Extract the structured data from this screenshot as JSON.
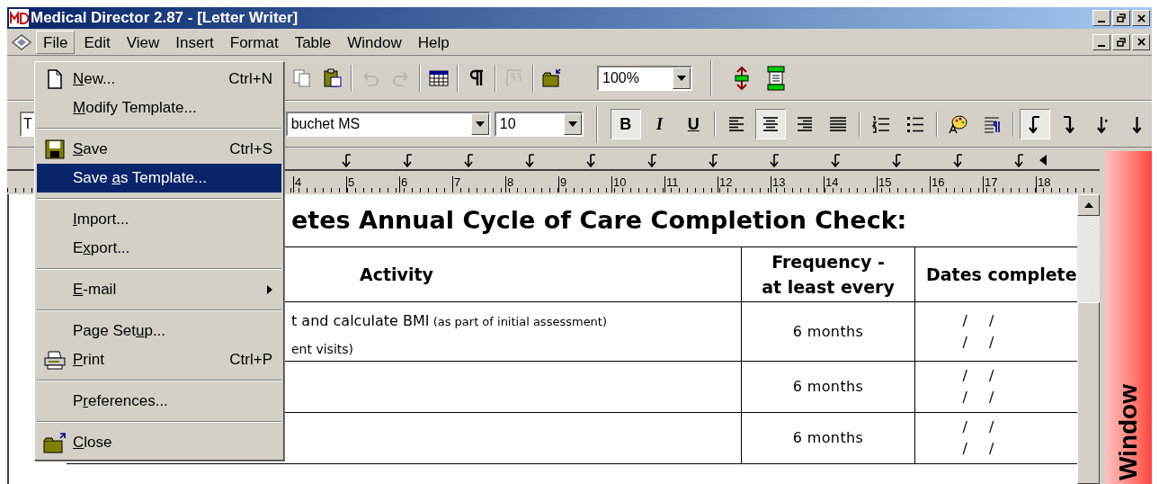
{
  "window": {
    "title": "Medical Director 2.87 - [Letter Writer]"
  },
  "menu_bar": [
    {
      "label": "File",
      "selected": true
    },
    {
      "label": "Edit",
      "selected": false
    },
    {
      "label": "View",
      "selected": false
    },
    {
      "label": "Insert",
      "selected": false
    },
    {
      "label": "Format",
      "selected": false
    },
    {
      "label": "Table",
      "selected": false
    },
    {
      "label": "Window",
      "selected": false
    },
    {
      "label": "Help",
      "selected": false
    }
  ],
  "toolbar": [
    {
      "kind": "copy",
      "disabled": false
    },
    {
      "kind": "paste",
      "disabled": false
    },
    {
      "kind": "sep"
    },
    {
      "kind": "undo",
      "disabled": true
    },
    {
      "kind": "redo",
      "disabled": true
    },
    {
      "kind": "sep"
    },
    {
      "kind": "table",
      "disabled": false
    },
    {
      "kind": "sep"
    },
    {
      "kind": "pilcrow",
      "disabled": false
    },
    {
      "kind": "sep"
    },
    {
      "kind": "fields",
      "disabled": true
    },
    {
      "kind": "sep"
    },
    {
      "kind": "close",
      "disabled": false
    }
  ],
  "zoom": {
    "value": "100%"
  },
  "format_bar": {
    "style_value": "T",
    "font_value": "buchet MS",
    "size_value": "10"
  },
  "format_buttons": [
    {
      "kind": "bold",
      "label": "B",
      "pressed": true
    },
    {
      "kind": "italic",
      "label": "I",
      "pressed": false
    },
    {
      "kind": "underline",
      "label": "U",
      "pressed": false
    },
    {
      "kind": "sep"
    },
    {
      "kind": "align-left",
      "pressed": false
    },
    {
      "kind": "align-center",
      "pressed": true
    },
    {
      "kind": "align-right",
      "pressed": false
    },
    {
      "kind": "justify",
      "pressed": false
    },
    {
      "kind": "sep"
    },
    {
      "kind": "numbered",
      "pressed": false
    },
    {
      "kind": "bullets",
      "pressed": false
    },
    {
      "kind": "sep"
    },
    {
      "kind": "palette",
      "pressed": false
    },
    {
      "kind": "para",
      "pressed": false
    },
    {
      "kind": "sep"
    },
    {
      "kind": "tab-left",
      "pressed": true
    },
    {
      "kind": "tab-right",
      "pressed": false
    },
    {
      "kind": "tab-decimal",
      "pressed": false
    },
    {
      "kind": "tab-center",
      "pressed": false
    }
  ],
  "ruler": [
    "4",
    "5",
    "6",
    "7",
    "8",
    "9",
    "10",
    "11",
    "12",
    "13",
    "14",
    "15",
    "16",
    "17",
    "18"
  ],
  "file_menu": [
    {
      "kind": "new",
      "key": "N",
      "post": "ew...",
      "shortcut": "Ctrl+N",
      "selected": false
    },
    {
      "kind": "item",
      "key": "M",
      "post": "odify Template...",
      "selected": false
    },
    {
      "kind": "separator"
    },
    {
      "kind": "save",
      "key": "S",
      "post": "ave",
      "shortcut": "Ctrl+S",
      "selected": false
    },
    {
      "kind": "item",
      "pre": "Save ",
      "key": "a",
      "post": "s Template...",
      "selected": true
    },
    {
      "kind": "separator"
    },
    {
      "kind": "item",
      "key": "I",
      "post": "mport...",
      "selected": false
    },
    {
      "kind": "item",
      "pre": "E",
      "key": "x",
      "post": "port...",
      "selected": false
    },
    {
      "kind": "separator"
    },
    {
      "kind": "submenu",
      "key": "E",
      "post": "-mail",
      "selected": false
    },
    {
      "kind": "separator"
    },
    {
      "kind": "item",
      "pre": "Page Set",
      "key": "u",
      "post": "p...",
      "selected": false
    },
    {
      "kind": "print",
      "key": "P",
      "post": "rint",
      "shortcut": "Ctrl+P",
      "selected": false
    },
    {
      "kind": "separator"
    },
    {
      "kind": "item",
      "pre": "P",
      "key": "r",
      "post": "eferences...",
      "selected": false
    },
    {
      "kind": "separator"
    },
    {
      "kind": "close",
      "key": "C",
      "post": "lose",
      "selected": false
    }
  ],
  "document": {
    "title": "etes Annual Cycle of Care Completion Check:",
    "columns": [
      "Activity",
      "Frequency -\nat least every",
      "Dates complete"
    ],
    "rows": [
      {
        "activity": [
          "t and calculate BMI",
          "ent visits)"
        ],
        "note": "(as part of initial assessment)",
        "frequency": "6 months",
        "dates": [
          [
            "/",
            "/"
          ],
          [
            "/",
            "/"
          ]
        ]
      },
      {
        "activity": [],
        "frequency": "6 months",
        "dates": [
          [
            "/",
            "/"
          ],
          [
            "/",
            "/"
          ]
        ]
      },
      {
        "activity": [],
        "frequency": "6 months",
        "dates": [
          [
            "/",
            "/"
          ],
          [
            "/",
            "/"
          ]
        ]
      }
    ]
  },
  "side_panel": {
    "label": "Window"
  }
}
